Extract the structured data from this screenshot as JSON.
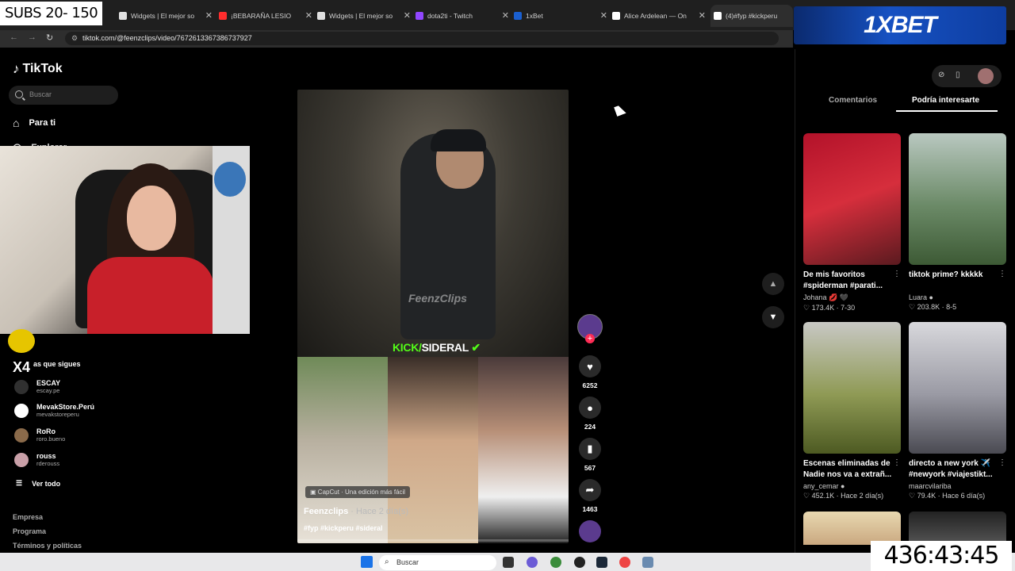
{
  "overlay": {
    "subs": "SUBS 20- 150",
    "timer": "436:43:45",
    "ad_text": "1XBET",
    "cam_badge": "X4"
  },
  "browser": {
    "tabs": [
      {
        "label": "Widgets | El mejor so",
        "fav": "#e0e0e0"
      },
      {
        "label": "¡BEBARAÑA LESIO",
        "fav": "#ff2d2d"
      },
      {
        "label": "Widgets | El mejor so",
        "fav": "#e0e0e0"
      },
      {
        "label": "dota2ti - Twitch",
        "fav": "#9146ff"
      },
      {
        "label": "1xBet",
        "fav": "#1a5fd0"
      },
      {
        "label": "Alice Ardelean — On",
        "fav": "#ffffff"
      },
      {
        "label": "(4)#fyp #kickperu",
        "fav": "#ffffff"
      }
    ],
    "url": "tiktok.com/@feenzclips/video/7672613367386737927"
  },
  "sidebar": {
    "logo": "TikTok",
    "search_placeholder": "Buscar",
    "nav": [
      {
        "label": "Para ti",
        "icon": "home-icon"
      },
      {
        "label": "Explorar",
        "icon": "compass-icon"
      }
    ],
    "following_title": "as que sigues",
    "following": [
      {
        "name": "ESCAY",
        "handle": "escay.pe"
      },
      {
        "name": "MevakStore.Perú",
        "handle": "mevakstoreperu"
      },
      {
        "name": "RoRo",
        "handle": "roro.bueno"
      },
      {
        "name": "rouss",
        "handle": "rderouss"
      }
    ],
    "see_all": "Ver todo",
    "footer": [
      "Empresa",
      "Programa",
      "Términos y políticas"
    ]
  },
  "video": {
    "watermark": "FeenzClips",
    "kick_prefix": "KICK/",
    "kick_name": "SIDERAL",
    "capcut": "CapCut · Una edición más fácil",
    "author": "Feenzclips",
    "time": " · Hace 2 día(s)",
    "tags": "#fyp #kickperu #sideral",
    "likes": "6252",
    "comments": "224",
    "saves": "567",
    "shares": "1463"
  },
  "panel": {
    "tabs": [
      "Comentarios",
      "Podría interesarte"
    ],
    "cards": [
      {
        "caption": "De mis favoritos #spiderman #parati...",
        "user": "Johana 💋 🖤",
        "stats": "♡ 173.4K · 7-30",
        "bg": "linear-gradient(160deg,#b3122a 0%,#d62e3c 50%,#5a1a1f 100%)"
      },
      {
        "caption": "tiktok prime? kkkkk",
        "user": "Luara ●",
        "stats": "♡ 203.8K · 8-5",
        "bg": "linear-gradient(180deg,#b9c8c0 0%,#6b8a67 55%,#3d5a35 100%)"
      },
      {
        "caption": "Escenas eliminadas de Nadie nos va a extrañ...",
        "user": "any_cemar ●",
        "stats": "♡ 452.1K · Hace 2 día(s)",
        "bg": "linear-gradient(180deg,#c8c8c4 0%,#8f9a55 55%,#4d5a22 100%)"
      },
      {
        "caption": "directo a new york ✈️ #newyork #viajestikt...",
        "user": "maarcvilariba",
        "stats": "♡ 79.4K · Hace 6 día(s)",
        "bg": "linear-gradient(180deg,#d8d8dc 0%,#9a9aa4 55%,#4a4a52 100%)"
      },
      {
        "caption": "",
        "user": "",
        "stats": "",
        "bg": "linear-gradient(180deg,#e8d8b0 0%,#caa880 100%)"
      },
      {
        "caption": "",
        "user": "",
        "stats": "",
        "bg": "linear-gradient(180deg,#222 0%,#555 100%)"
      }
    ]
  },
  "taskbar": {
    "search": "Buscar"
  }
}
